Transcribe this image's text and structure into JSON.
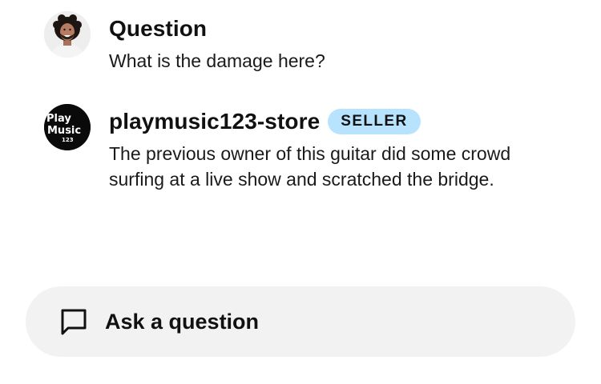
{
  "thread": {
    "question": {
      "author": "Question",
      "avatar_icon": "person-avatar",
      "text": "What is the damage here?"
    },
    "answer": {
      "author": "playmusic123-store",
      "badge": "SELLER",
      "avatar_icon": "store-logo",
      "logo_lines": [
        "Play",
        "Music",
        "123"
      ],
      "text": "The previous owner of this guitar did some crowd surfing at a live show and scratched the bridge."
    }
  },
  "ask_button": {
    "icon": "chat-bubble-icon",
    "label": "Ask a question"
  },
  "colors": {
    "badge_bg": "#b8e3ff",
    "ask_bar_bg": "#f2f2f2",
    "text": "#111111"
  }
}
